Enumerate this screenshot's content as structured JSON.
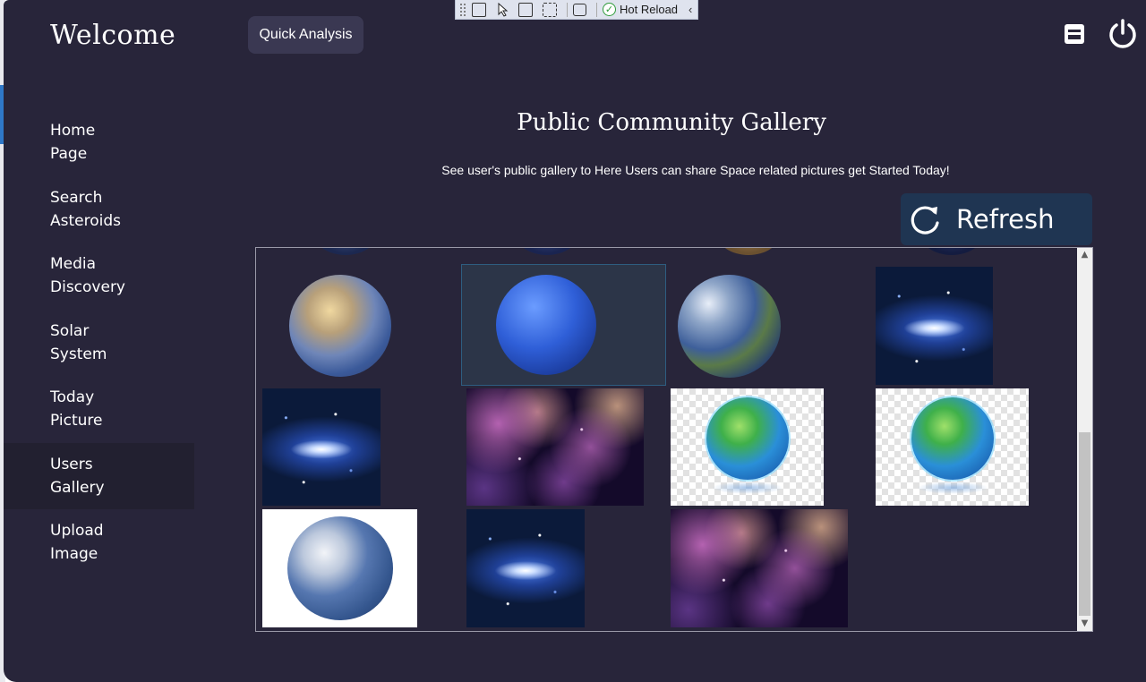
{
  "app": {
    "welcome": "Welcome",
    "quick_analysis": "Quick Analysis"
  },
  "devtoolbar": {
    "hot_reload": "Hot Reload"
  },
  "sidebar": {
    "items": [
      {
        "label": "Home\nPage",
        "active": false
      },
      {
        "label": "Search\nAsteroids",
        "active": false
      },
      {
        "label": "Media\nDiscovery",
        "active": false
      },
      {
        "label": "Solar\nSystem",
        "active": false
      },
      {
        "label": "Today\nPicture",
        "active": false
      },
      {
        "label": "Users\nGallery",
        "active": true
      },
      {
        "label": "Upload\nImage",
        "active": false
      }
    ]
  },
  "main": {
    "title": "Public Community Gallery",
    "subtitle": "See user's public gallery to Here Users can share Space related pictures get Started Today!",
    "refresh_label": "Refresh"
  },
  "gallery": {
    "images": [
      {
        "subject": "mercury-planet"
      },
      {
        "subject": "neptune-planet"
      },
      {
        "subject": "earth-planet"
      },
      {
        "subject": "blue-galaxy"
      },
      {
        "subject": "blue-galaxy"
      },
      {
        "subject": "purple-nebula"
      },
      {
        "subject": "globe-icon"
      },
      {
        "subject": "globe-icon"
      },
      {
        "subject": "earth-white-background"
      },
      {
        "subject": "blue-galaxy"
      },
      {
        "subject": "purple-nebula"
      }
    ]
  },
  "colors": {
    "background": "#28253a",
    "active_nav": "#222030",
    "refresh_button": "#1f3552",
    "quick_button": "#3a3852"
  }
}
